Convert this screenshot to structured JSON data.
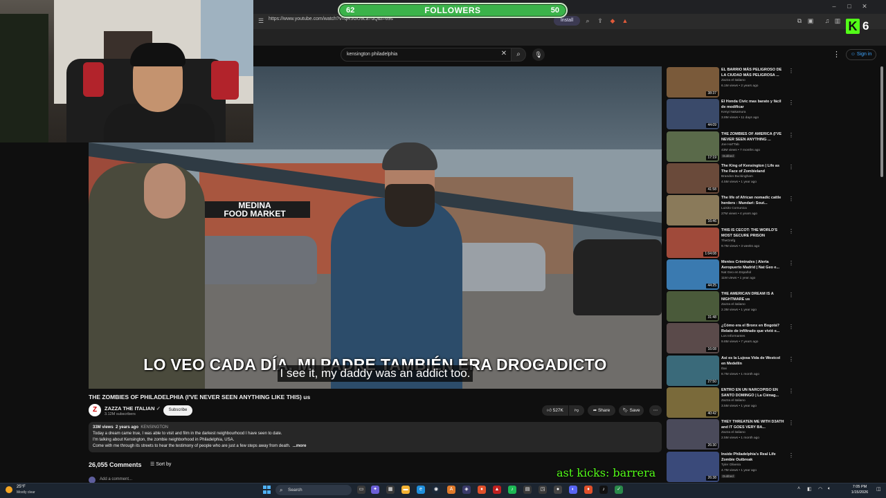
{
  "browser": {
    "url": "https://www.youtube.com/watch?v=qR5GU9La7dQ&t=69s",
    "install_label": "Install"
  },
  "overlay": {
    "followers_left": "62",
    "followers_label": "FOLLOWERS",
    "followers_right": "50",
    "followers_progress": 0.62,
    "kick_count": "6",
    "kick_letter": "K",
    "kicks_ticker": "ast kicks: barrera"
  },
  "youtube": {
    "search_value": "kensington philadelphia",
    "signin_label": "Sign in",
    "subtitle_es": "LO VEO CADA DÍA. MI PADRE TAMBIÉN ERA DROGADICTO",
    "subtitle_en": "I see it, my daddy was an addict too.",
    "video_store_line1": "MEDINA",
    "video_store_line2": "FOOD MARKET",
    "title": "THE ZOMBIES OF PHILADELPHIA (I'VE NEVER SEEN ANYTHING LIKE THIS) us",
    "channel": "ZAZZA THE ITALIAN",
    "subscribers": "3.12M subscribers",
    "subscribe_label": "Subscribe",
    "likes": "527K",
    "share_label": "Share",
    "save_label": "Save",
    "description": {
      "views": "33M views",
      "age": "2 years ago",
      "tag": "KENSINGTON",
      "line1": "Today a dream came true, I was able to visit and film in the darkest neighbourhood I have seen to date.",
      "line2": "I'm talking about Kensington, the zombie neighborhood in Philadelphia, USA.",
      "line3": "Come with me through its streets to hear the testimony of people who are just a few steps away from death.",
      "more": "...more"
    },
    "comments_count": "26,055 Comments",
    "sort_label": "Sort by",
    "add_comment": "Add a comment..."
  },
  "recommendations": [
    {
      "title": "EL BARRIO MÁS PELIGROSO DE LA CIUDAD MÁS PELIGROSA ...",
      "channel": "Zazza el italiano",
      "meta": "6.1M views • 2 years ago",
      "duration": "38:37",
      "color": "#7a5a3a"
    },
    {
      "title": "El Honda Civic mas barato y fácil de modificar",
      "channel": "Kenyi Nakamura",
      "meta": "3.8M views • 11 days ago",
      "duration": "44:09",
      "color": "#3a4a6a"
    },
    {
      "title": "THE ZOMBIES OF AMERICA (I'VE NEVER SEEN ANYTHING ...",
      "channel": "Joe HaTTab",
      "meta": "43M views • 7 months ago",
      "duration": "17:19",
      "badge": "Dubbed",
      "color": "#5a6a4a"
    },
    {
      "title": "The King of Kensington | Life as The Face of Zombieland",
      "channel": "Brandon Buckingham",
      "meta": "4.5M views • 1 year ago",
      "duration": "41:58",
      "color": "#6a4a3a"
    },
    {
      "title": "The life of African nomadic cattle herders : Mundari: Sout...",
      "channel": "Luisito Comunica",
      "meta": "27M views • 4 years ago",
      "duration": "16:46",
      "color": "#8a7a5a"
    },
    {
      "title": "THIS IS CECOT: THE WORLD'S MOST SECURE PRISON",
      "channel": "TheGrefg",
      "meta": "9.7M views • 3 weeks ago",
      "duration": "1:04:08",
      "color": "#a04a3a"
    },
    {
      "title": "Mentes Criminales | Alerta Aeropuerto Madrid | Nat Geo e...",
      "channel": "Nat Geo en Español",
      "meta": "11M views • 1 year ago",
      "duration": "44:25",
      "color": "#3a7ab0"
    },
    {
      "title": "THE AMERICAN DREAM IS A NIGHTMARE us",
      "channel": "Zazza el italiano",
      "meta": "2.3M views • 1 year ago",
      "duration": "31:48",
      "color": "#4a5a3a"
    },
    {
      "title": "¿Cómo era el Bronx en Bogotá? Relato de infiltrado que vivió e...",
      "channel": "Los Informantes",
      "meta": "9.8M views • 7 years ago",
      "duration": "16:08",
      "color": "#5a4a4a"
    },
    {
      "title": "Asi es la Lujosa Vida de Westcol en Medellín",
      "channel": "Ibai",
      "meta": "8.7M views • 1 month ago",
      "duration": "27:50",
      "color": "#3a6a7a"
    },
    {
      "title": "ENTRO EN UN NARCOPISO EN SANTO DOMINGO | La Ciénag...",
      "channel": "Zazza el italiano",
      "meta": "3.5M views • 1 year ago",
      "duration": "40:42",
      "color": "#7a6a3a"
    },
    {
      "title": "THEY THREATEN ME WITH D3ATH and IT GOES VERY BA...",
      "channel": "Zazza el italiano",
      "meta": "2.5M views • 1 month ago",
      "duration": "26:30",
      "color": "#4a4a5a"
    },
    {
      "title": "Inside Philadelphia's Real Life Zombie Outbreak",
      "channel": "Tyler Oliveira",
      "meta": "4.7M views • 1 year ago",
      "duration": "26:38",
      "badge": "Dubbed",
      "color": "#3a4a7a"
    }
  ],
  "taskbar": {
    "temp": "25°F",
    "condition": "Mostly clear",
    "search_label": "Search",
    "time": "7:05 PM",
    "date": "1/15/2026"
  }
}
